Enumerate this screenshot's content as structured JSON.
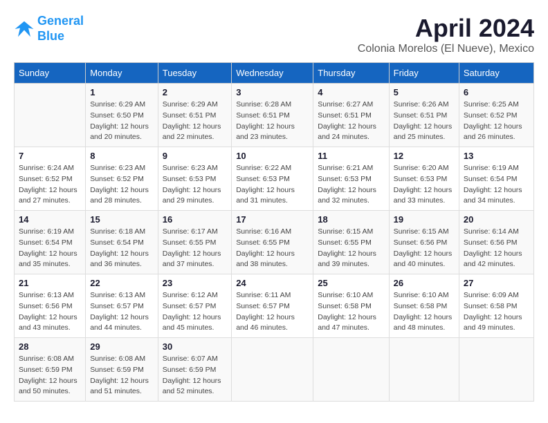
{
  "logo": {
    "line1": "General",
    "line2": "Blue"
  },
  "title": "April 2024",
  "subtitle": "Colonia Morelos (El Nueve), Mexico",
  "days_header": [
    "Sunday",
    "Monday",
    "Tuesday",
    "Wednesday",
    "Thursday",
    "Friday",
    "Saturday"
  ],
  "weeks": [
    [
      {
        "day": "",
        "sunrise": "",
        "sunset": "",
        "daylight": ""
      },
      {
        "day": "1",
        "sunrise": "Sunrise: 6:29 AM",
        "sunset": "Sunset: 6:50 PM",
        "daylight": "Daylight: 12 hours and 20 minutes."
      },
      {
        "day": "2",
        "sunrise": "Sunrise: 6:29 AM",
        "sunset": "Sunset: 6:51 PM",
        "daylight": "Daylight: 12 hours and 22 minutes."
      },
      {
        "day": "3",
        "sunrise": "Sunrise: 6:28 AM",
        "sunset": "Sunset: 6:51 PM",
        "daylight": "Daylight: 12 hours and 23 minutes."
      },
      {
        "day": "4",
        "sunrise": "Sunrise: 6:27 AM",
        "sunset": "Sunset: 6:51 PM",
        "daylight": "Daylight: 12 hours and 24 minutes."
      },
      {
        "day": "5",
        "sunrise": "Sunrise: 6:26 AM",
        "sunset": "Sunset: 6:51 PM",
        "daylight": "Daylight: 12 hours and 25 minutes."
      },
      {
        "day": "6",
        "sunrise": "Sunrise: 6:25 AM",
        "sunset": "Sunset: 6:52 PM",
        "daylight": "Daylight: 12 hours and 26 minutes."
      }
    ],
    [
      {
        "day": "7",
        "sunrise": "Sunrise: 6:24 AM",
        "sunset": "Sunset: 6:52 PM",
        "daylight": "Daylight: 12 hours and 27 minutes."
      },
      {
        "day": "8",
        "sunrise": "Sunrise: 6:23 AM",
        "sunset": "Sunset: 6:52 PM",
        "daylight": "Daylight: 12 hours and 28 minutes."
      },
      {
        "day": "9",
        "sunrise": "Sunrise: 6:23 AM",
        "sunset": "Sunset: 6:53 PM",
        "daylight": "Daylight: 12 hours and 29 minutes."
      },
      {
        "day": "10",
        "sunrise": "Sunrise: 6:22 AM",
        "sunset": "Sunset: 6:53 PM",
        "daylight": "Daylight: 12 hours and 31 minutes."
      },
      {
        "day": "11",
        "sunrise": "Sunrise: 6:21 AM",
        "sunset": "Sunset: 6:53 PM",
        "daylight": "Daylight: 12 hours and 32 minutes."
      },
      {
        "day": "12",
        "sunrise": "Sunrise: 6:20 AM",
        "sunset": "Sunset: 6:53 PM",
        "daylight": "Daylight: 12 hours and 33 minutes."
      },
      {
        "day": "13",
        "sunrise": "Sunrise: 6:19 AM",
        "sunset": "Sunset: 6:54 PM",
        "daylight": "Daylight: 12 hours and 34 minutes."
      }
    ],
    [
      {
        "day": "14",
        "sunrise": "Sunrise: 6:19 AM",
        "sunset": "Sunset: 6:54 PM",
        "daylight": "Daylight: 12 hours and 35 minutes."
      },
      {
        "day": "15",
        "sunrise": "Sunrise: 6:18 AM",
        "sunset": "Sunset: 6:54 PM",
        "daylight": "Daylight: 12 hours and 36 minutes."
      },
      {
        "day": "16",
        "sunrise": "Sunrise: 6:17 AM",
        "sunset": "Sunset: 6:55 PM",
        "daylight": "Daylight: 12 hours and 37 minutes."
      },
      {
        "day": "17",
        "sunrise": "Sunrise: 6:16 AM",
        "sunset": "Sunset: 6:55 PM",
        "daylight": "Daylight: 12 hours and 38 minutes."
      },
      {
        "day": "18",
        "sunrise": "Sunrise: 6:15 AM",
        "sunset": "Sunset: 6:55 PM",
        "daylight": "Daylight: 12 hours and 39 minutes."
      },
      {
        "day": "19",
        "sunrise": "Sunrise: 6:15 AM",
        "sunset": "Sunset: 6:56 PM",
        "daylight": "Daylight: 12 hours and 40 minutes."
      },
      {
        "day": "20",
        "sunrise": "Sunrise: 6:14 AM",
        "sunset": "Sunset: 6:56 PM",
        "daylight": "Daylight: 12 hours and 42 minutes."
      }
    ],
    [
      {
        "day": "21",
        "sunrise": "Sunrise: 6:13 AM",
        "sunset": "Sunset: 6:56 PM",
        "daylight": "Daylight: 12 hours and 43 minutes."
      },
      {
        "day": "22",
        "sunrise": "Sunrise: 6:13 AM",
        "sunset": "Sunset: 6:57 PM",
        "daylight": "Daylight: 12 hours and 44 minutes."
      },
      {
        "day": "23",
        "sunrise": "Sunrise: 6:12 AM",
        "sunset": "Sunset: 6:57 PM",
        "daylight": "Daylight: 12 hours and 45 minutes."
      },
      {
        "day": "24",
        "sunrise": "Sunrise: 6:11 AM",
        "sunset": "Sunset: 6:57 PM",
        "daylight": "Daylight: 12 hours and 46 minutes."
      },
      {
        "day": "25",
        "sunrise": "Sunrise: 6:10 AM",
        "sunset": "Sunset: 6:58 PM",
        "daylight": "Daylight: 12 hours and 47 minutes."
      },
      {
        "day": "26",
        "sunrise": "Sunrise: 6:10 AM",
        "sunset": "Sunset: 6:58 PM",
        "daylight": "Daylight: 12 hours and 48 minutes."
      },
      {
        "day": "27",
        "sunrise": "Sunrise: 6:09 AM",
        "sunset": "Sunset: 6:58 PM",
        "daylight": "Daylight: 12 hours and 49 minutes."
      }
    ],
    [
      {
        "day": "28",
        "sunrise": "Sunrise: 6:08 AM",
        "sunset": "Sunset: 6:59 PM",
        "daylight": "Daylight: 12 hours and 50 minutes."
      },
      {
        "day": "29",
        "sunrise": "Sunrise: 6:08 AM",
        "sunset": "Sunset: 6:59 PM",
        "daylight": "Daylight: 12 hours and 51 minutes."
      },
      {
        "day": "30",
        "sunrise": "Sunrise: 6:07 AM",
        "sunset": "Sunset: 6:59 PM",
        "daylight": "Daylight: 12 hours and 52 minutes."
      },
      {
        "day": "",
        "sunrise": "",
        "sunset": "",
        "daylight": ""
      },
      {
        "day": "",
        "sunrise": "",
        "sunset": "",
        "daylight": ""
      },
      {
        "day": "",
        "sunrise": "",
        "sunset": "",
        "daylight": ""
      },
      {
        "day": "",
        "sunrise": "",
        "sunset": "",
        "daylight": ""
      }
    ]
  ]
}
